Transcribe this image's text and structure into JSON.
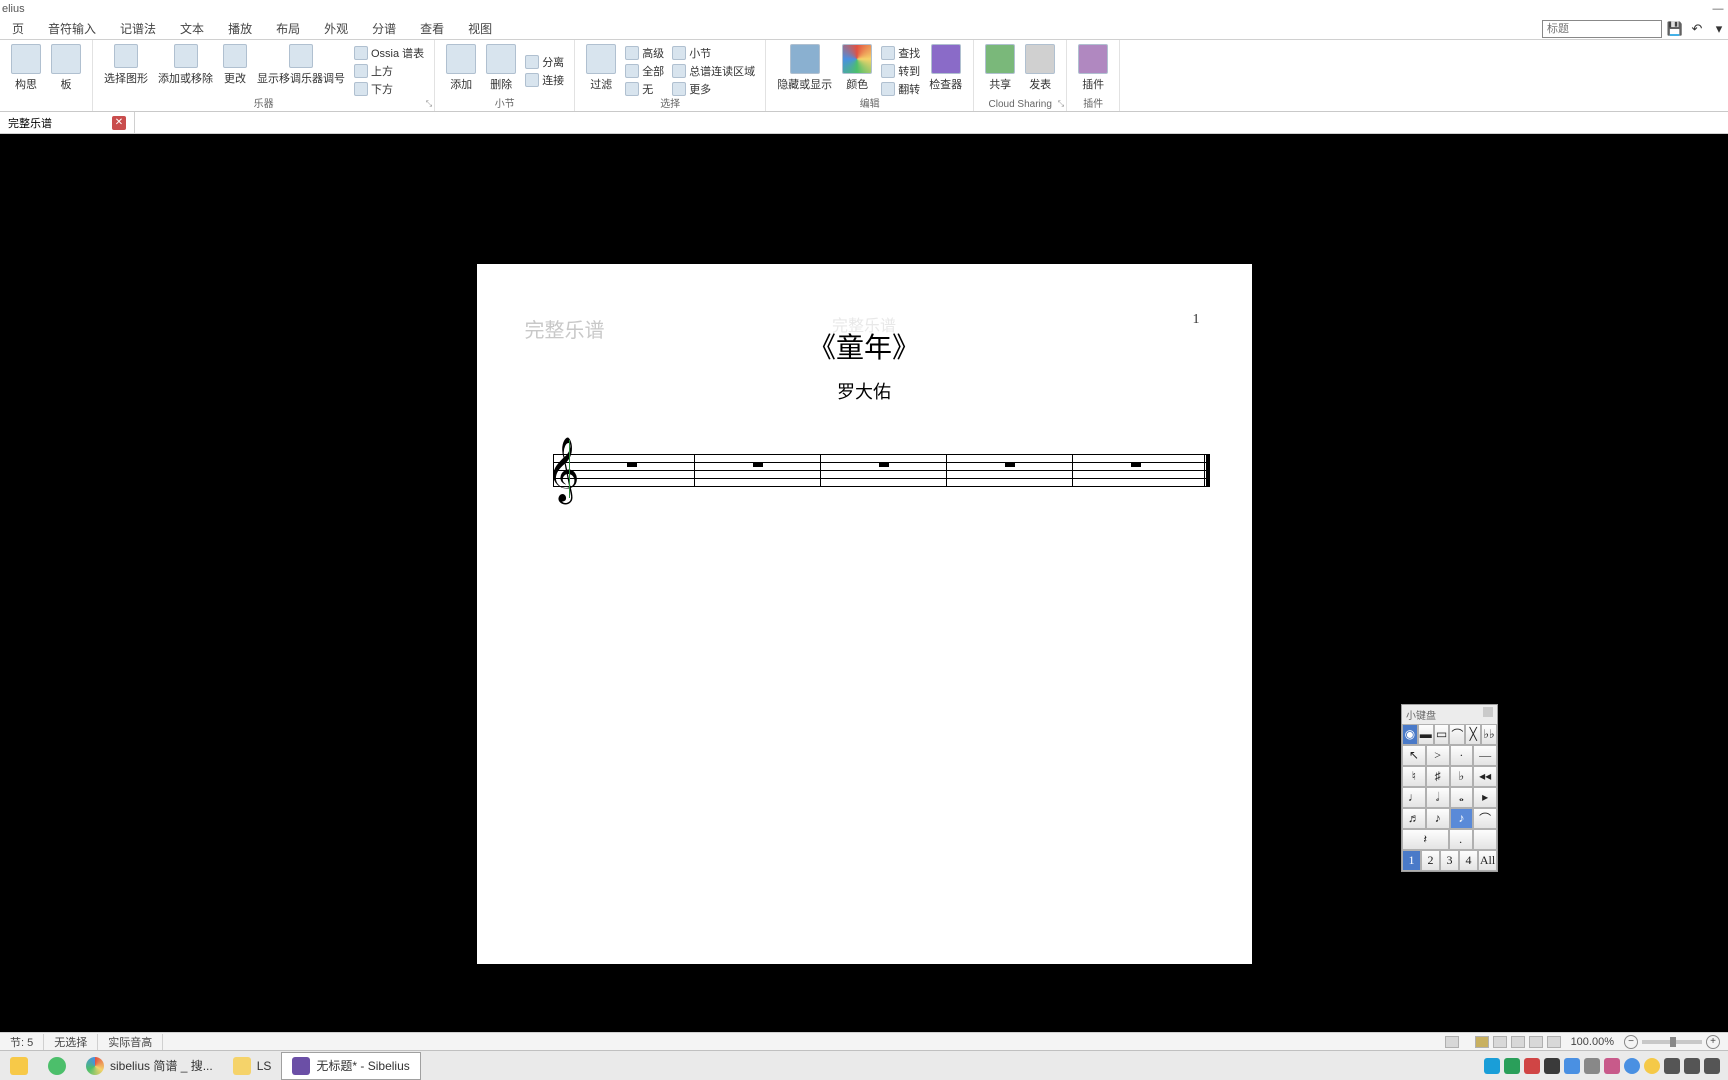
{
  "titlebar": {
    "app": "elius"
  },
  "menu": {
    "tabs": [
      "页",
      "音符输入",
      "记谱法",
      "文本",
      "播放",
      "布局",
      "外观",
      "分谱",
      "查看",
      "视图"
    ],
    "search_placeholder": "标题"
  },
  "ribbon": {
    "g1": {
      "btn1": "构思",
      "btn2": "板",
      "label": ""
    },
    "g2": {
      "btn1": "选择图形",
      "btn2": "添加或移除",
      "btn3": "更改",
      "btn4": "显示移调乐器调号",
      "r1": "Ossia 谱表",
      "r2": "上方",
      "r3": "下方",
      "label": "乐器"
    },
    "g3": {
      "btn1": "添加",
      "btn2": "删除",
      "r1": "分离",
      "r2": "连接",
      "label": "小节"
    },
    "g4": {
      "btn1": "过滤",
      "r1": "高级",
      "r2": "全部",
      "r3": "无",
      "c1": "小节",
      "c2": "总谱连读区域",
      "c3": "更多",
      "label": "选择"
    },
    "g5": {
      "btn1": "隐藏或显示",
      "btn2": "颜色",
      "r1": "查找",
      "r2": "转到",
      "r3": "翻转",
      "btn3": "检查器",
      "label": "编辑"
    },
    "g6": {
      "btn1": "共享",
      "btn2": "发表",
      "label": "Cloud Sharing"
    },
    "g7": {
      "btn1": "插件",
      "label": "插件"
    }
  },
  "doctab": {
    "name": "完整乐谱"
  },
  "score": {
    "part": "完整乐谱",
    "watermark": "完整乐谱",
    "pagenum": "1",
    "title": "《童年》",
    "composer": "罗大佑"
  },
  "keypad": {
    "title": "小键盘",
    "tabs": [
      "1",
      "2",
      "3",
      "4",
      "All"
    ]
  },
  "status": {
    "bars": "节: 5",
    "sel": "无选择",
    "pitch": "实际音高",
    "zoom": "100.00%"
  },
  "taskbar": {
    "items": [
      {
        "label": "",
        "color": "#f7c948"
      },
      {
        "label": "",
        "color": "#4cbf6b"
      },
      {
        "label": "sibelius 简谱 _ 搜...",
        "color": "#e25141"
      },
      {
        "label": "LS",
        "color": "#f5d36a"
      },
      {
        "label": "无标题* - Sibelius",
        "color": "#6b4fa6",
        "active": true
      }
    ]
  }
}
